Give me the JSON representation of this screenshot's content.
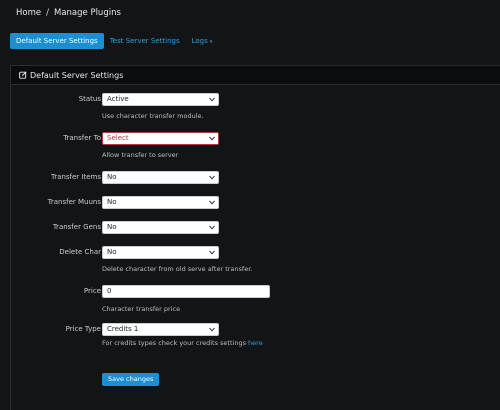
{
  "breadcrumb": {
    "home": "Home",
    "separator": "/",
    "current": "Manage Plugins"
  },
  "tabs": [
    {
      "label": "Default Server Settings",
      "active": true
    },
    {
      "label": "Test Server Settings",
      "active": false
    },
    {
      "label": "Logs",
      "active": false,
      "caret": "▾"
    }
  ],
  "panel": {
    "title": "Default Server Settings",
    "icon": "edit-icon"
  },
  "form": {
    "status": {
      "label": "Status",
      "value": "Active",
      "help": "Use character transfer module."
    },
    "transfer_to": {
      "label": "Transfer To",
      "value": "Select",
      "help": "Allow transfer to server"
    },
    "transfer_items": {
      "label": "Transfer Items",
      "value": "No"
    },
    "transfer_muuns": {
      "label": "Transfer Muuns",
      "value": "No"
    },
    "transfer_gens": {
      "label": "Transfer Gens",
      "value": "No"
    },
    "delete_char": {
      "label": "Delete Char",
      "value": "No",
      "help": "Delete character from old serve after transfer."
    },
    "price": {
      "label": "Price",
      "value": "0",
      "help": "Character transfer price"
    },
    "price_type": {
      "label": "Price Type",
      "value": "Credits 1",
      "help": "For credits types check your credits settings",
      "help_link": "here"
    }
  },
  "save_button": "Save changes",
  "colors": {
    "accent": "#1b8fd2",
    "error": "#b23b3b",
    "background": "#131416"
  }
}
